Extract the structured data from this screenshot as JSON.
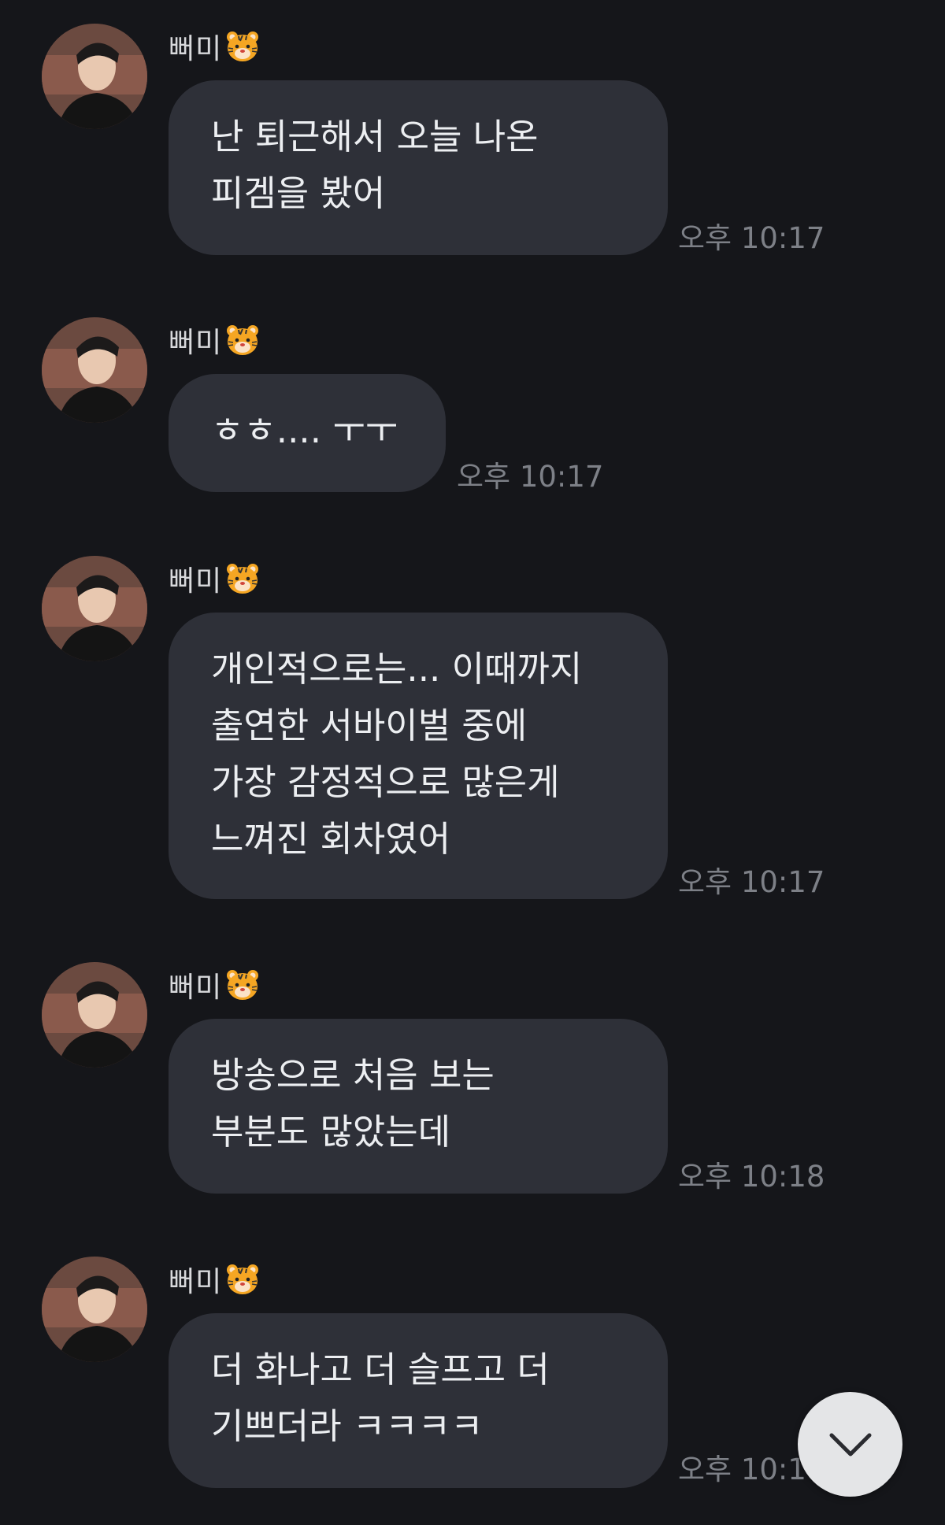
{
  "messages": [
    {
      "sender": "뻐미",
      "sender_emoji": "tiger-face",
      "lines": [
        "난 퇴근해서 오늘 나온",
        "피겜을 봤어"
      ],
      "time": "오후 10:17"
    },
    {
      "sender": "뻐미",
      "sender_emoji": "tiger-face",
      "lines": [
        "ㅎㅎ.... ㅜㅜ"
      ],
      "time": "오후 10:17"
    },
    {
      "sender": "뻐미",
      "sender_emoji": "tiger-face",
      "lines": [
        "개인적으로는... 이때까지",
        "출연한 서바이벌 중에",
        "가장 감정적으로 많은게",
        "느껴진 회차였어"
      ],
      "time": "오후 10:17"
    },
    {
      "sender": "뻐미",
      "sender_emoji": "tiger-face",
      "lines": [
        "방송으로 처음 보는",
        "부분도 많았는데"
      ],
      "time": "오후 10:18"
    },
    {
      "sender": "뻐미",
      "sender_emoji": "tiger-face",
      "lines": [
        "더 화나고 더 슬프고 더",
        "기쁘더라 ㅋㅋㅋㅋ"
      ],
      "time": "오후 10:1"
    }
  ],
  "scroll_button": {
    "icon": "chevron-down-icon"
  },
  "colors": {
    "background": "#15161a",
    "bubble": "#2e3038",
    "text": "#eceef1",
    "timestamp": "#7d8087",
    "scroll_button": "#e4e5e7"
  }
}
